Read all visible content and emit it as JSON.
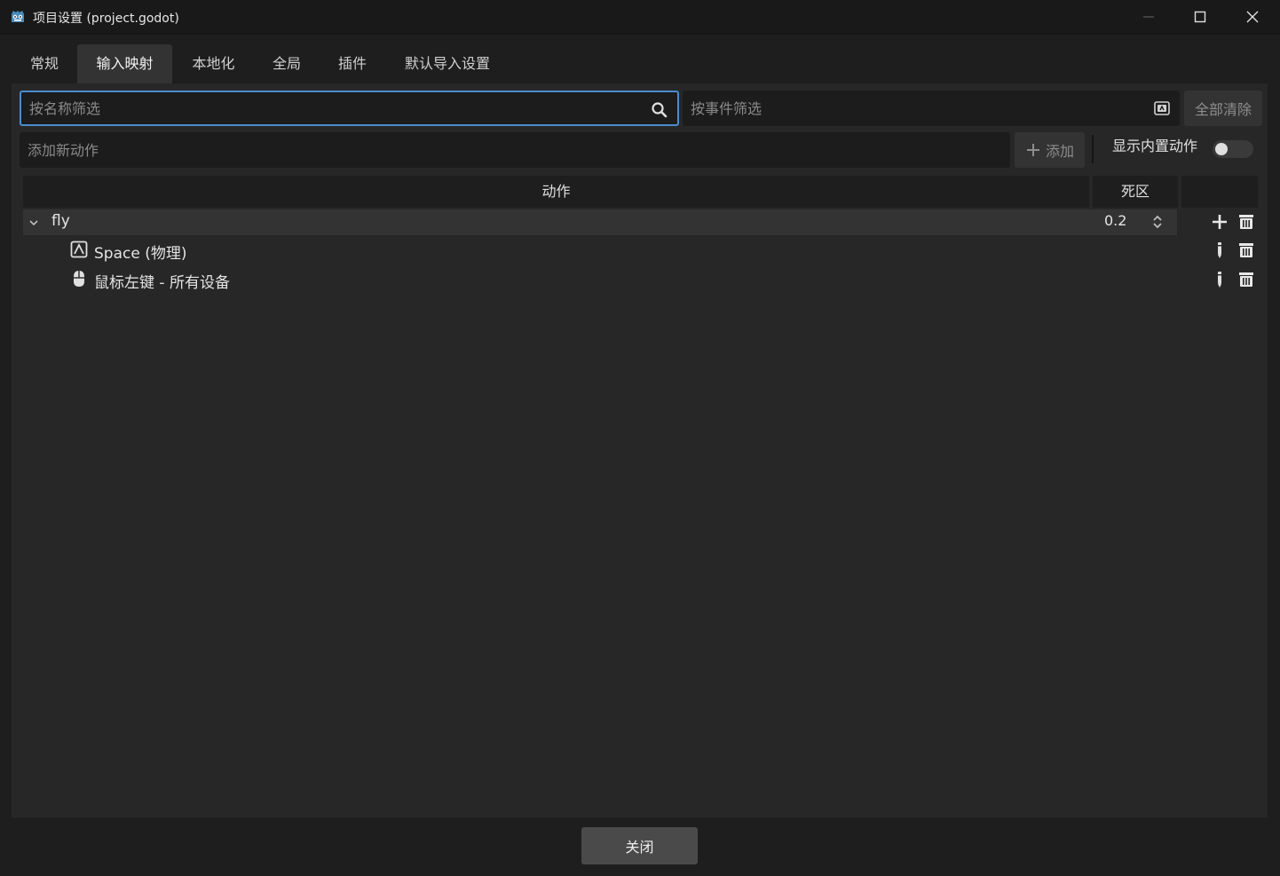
{
  "window": {
    "title": "项目设置 (project.godot)"
  },
  "tabs": [
    {
      "label": "常规",
      "active": false
    },
    {
      "label": "输入映射",
      "active": true
    },
    {
      "label": "本地化",
      "active": false
    },
    {
      "label": "全局",
      "active": false
    },
    {
      "label": "插件",
      "active": false
    },
    {
      "label": "默认导入设置",
      "active": false
    }
  ],
  "filters": {
    "name_placeholder": "按名称筛选",
    "event_placeholder": "按事件筛选",
    "clear_all_label": "全部清除"
  },
  "add_action": {
    "placeholder": "添加新动作",
    "add_label": "添加",
    "show_builtin_label": "显示内置动作",
    "show_builtin_enabled": false
  },
  "table": {
    "headers": {
      "action": "动作",
      "deadzone": "死区"
    },
    "actions": [
      {
        "name": "fly",
        "deadzone": "0.2",
        "expanded": true,
        "events": [
          {
            "icon": "keyboard-icon",
            "label": "Space (物理)"
          },
          {
            "icon": "mouse-icon",
            "label": "鼠标左键 - 所有设备"
          }
        ]
      }
    ]
  },
  "footer": {
    "close_label": "关闭"
  },
  "colors": {
    "accent": "#4b8bd0",
    "panel": "#272727",
    "background": "#1e1e1e"
  }
}
